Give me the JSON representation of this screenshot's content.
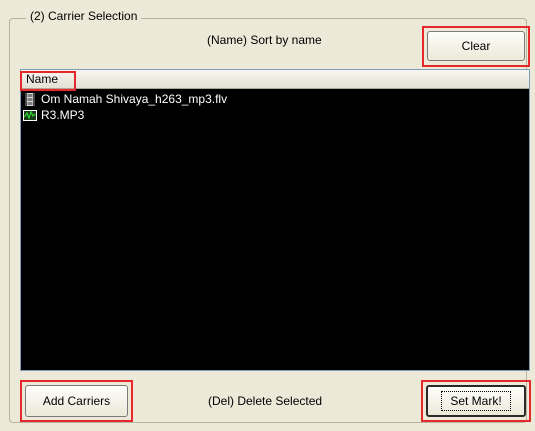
{
  "group": {
    "title": "(2) Carrier Selection"
  },
  "hints": {
    "sort": "(Name) Sort by name",
    "delete": "(Del) Delete Selected"
  },
  "buttons": {
    "clear": "Clear",
    "add_carriers": "Add Carriers",
    "set_mark": "Set Mark!"
  },
  "list": {
    "column_name": "Name",
    "items": [
      {
        "name": "Om Namah Shivaya_h263_mp3.flv",
        "icon": "film-strip-icon"
      },
      {
        "name": "R3.MP3",
        "icon": "audio-waveform-icon"
      }
    ]
  },
  "colors": {
    "highlight": "#e6272b",
    "list_bg": "#000000"
  }
}
